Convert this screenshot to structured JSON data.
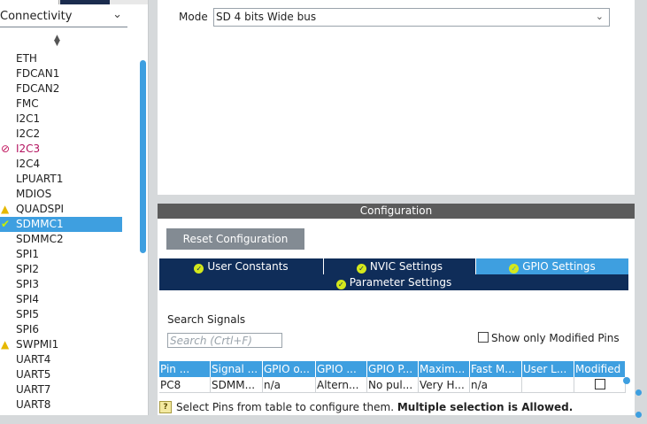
{
  "left_panel": {
    "category_label": "Connectivity",
    "peripherals": [
      {
        "name": "ETH",
        "status": "none"
      },
      {
        "name": "FDCAN1",
        "status": "none"
      },
      {
        "name": "FDCAN2",
        "status": "none"
      },
      {
        "name": "FMC",
        "status": "none"
      },
      {
        "name": "I2C1",
        "status": "none"
      },
      {
        "name": "I2C2",
        "status": "none"
      },
      {
        "name": "I2C3",
        "status": "disabled"
      },
      {
        "name": "I2C4",
        "status": "none"
      },
      {
        "name": "LPUART1",
        "status": "none"
      },
      {
        "name": "MDIOS",
        "status": "none"
      },
      {
        "name": "QUADSPI",
        "status": "warning"
      },
      {
        "name": "SDMMC1",
        "status": "configured",
        "selected": true
      },
      {
        "name": "SDMMC2",
        "status": "none"
      },
      {
        "name": "SPI1",
        "status": "none"
      },
      {
        "name": "SPI2",
        "status": "none"
      },
      {
        "name": "SPI3",
        "status": "none"
      },
      {
        "name": "SPI4",
        "status": "none"
      },
      {
        "name": "SPI5",
        "status": "none"
      },
      {
        "name": "SPI6",
        "status": "none"
      },
      {
        "name": "SWPMI1",
        "status": "warning"
      },
      {
        "name": "UART4",
        "status": "none"
      },
      {
        "name": "UART5",
        "status": "none"
      },
      {
        "name": "UART7",
        "status": "none"
      },
      {
        "name": "UART8",
        "status": "none"
      }
    ]
  },
  "mode": {
    "label": "Mode",
    "value": "SD 4 bits Wide bus"
  },
  "configuration": {
    "header": "Configuration",
    "reset_button": "Reset Configuration",
    "tabs": [
      {
        "label": "User Constants",
        "active": false
      },
      {
        "label": "NVIC Settings",
        "active": false
      },
      {
        "label": "GPIO Settings",
        "active": true
      },
      {
        "label": "Parameter Settings",
        "active": false
      }
    ],
    "search_label": "Search Signals",
    "search_placeholder": "Search (Crtl+F)",
    "show_modified_label": "Show only Modified Pins",
    "table": {
      "columns": [
        "Pin ...",
        "Signal ...",
        "GPIO o...",
        "GPIO ...",
        "GPIO P...",
        "Maxim...",
        "Fast M...",
        "User L...",
        "Modified"
      ],
      "rows": [
        [
          "PC8",
          "SDMM...",
          "n/a",
          "Altern...",
          "No pul...",
          "Very H...",
          "n/a",
          "",
          ""
        ]
      ]
    },
    "hint_text": "Select Pins from table to configure them. ",
    "hint_bold": "Multiple selection is Allowed."
  },
  "colors": {
    "accent": "#3e9fe0",
    "tab_dark": "#0f2d59",
    "header_gray": "#5b5b5b",
    "disabled": "#b3135f",
    "warning": "#e6b800"
  }
}
